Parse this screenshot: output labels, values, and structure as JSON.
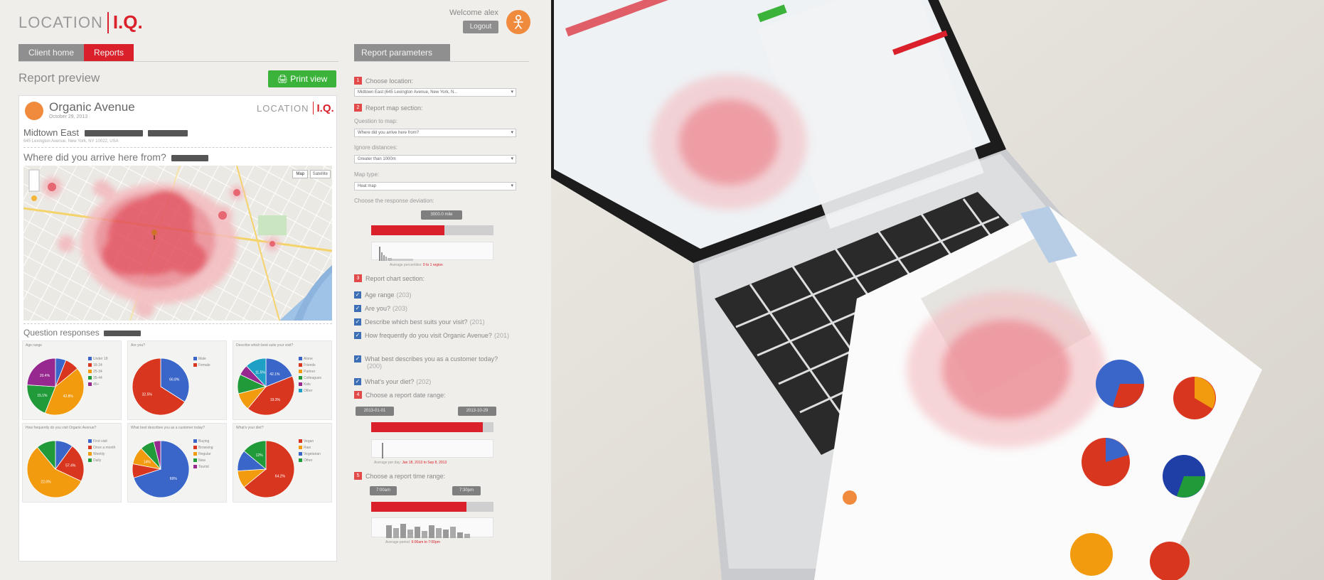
{
  "header": {
    "logo_left": "LOCATION",
    "logo_right": "I.Q.",
    "welcome": "Welcome alex",
    "logout_label": "Logout"
  },
  "breadcrumb": {
    "home": "Client home",
    "current": "Reports"
  },
  "preview": {
    "title": "Report preview",
    "print_label": "Print view"
  },
  "report": {
    "org": "Organic Avenue",
    "date": "October 29, 2013",
    "logo_left": "LOCATION",
    "logo_right": "I.Q.",
    "location": "Midtown East",
    "address": "645 Lexington Avenue, New York, NY 10022, USA",
    "question": "Where did you arrive here from?",
    "responses_title": "Question responses",
    "map_toggle": {
      "map": "Map",
      "satellite": "Satellite"
    }
  },
  "pies": [
    {
      "title": "Age range",
      "slices": [
        {
          "label": "Under 18",
          "value": 6,
          "color": "#3a66c9"
        },
        {
          "label": "18-24",
          "value": 8,
          "color": "#d9361f"
        },
        {
          "label": "25-34",
          "value": 42,
          "color": "#f39b0f"
        },
        {
          "label": "35-44",
          "value": 20,
          "color": "#219a3a"
        },
        {
          "label": "45+",
          "value": 24,
          "color": "#96288f"
        }
      ],
      "pct": [
        "42.8%",
        "20.4%",
        "15.1%"
      ]
    },
    {
      "title": "Are you?",
      "slices": [
        {
          "label": "Male",
          "value": 34,
          "color": "#3a66c9"
        },
        {
          "label": "Female",
          "value": 66,
          "color": "#d9361f"
        }
      ],
      "pct": [
        "32.5%",
        "66.8%"
      ]
    },
    {
      "title": "Describe which best suits your visit?",
      "slices": [
        {
          "label": "Alone",
          "value": 19,
          "color": "#3a66c9"
        },
        {
          "label": "Friends",
          "value": 42,
          "color": "#d9361f"
        },
        {
          "label": "Partner",
          "value": 10,
          "color": "#f39b0f"
        },
        {
          "label": "Colleagues",
          "value": 11,
          "color": "#219a3a"
        },
        {
          "label": "Kids",
          "value": 6,
          "color": "#96288f"
        },
        {
          "label": "Other",
          "value": 12,
          "color": "#1e9fc4"
        }
      ],
      "pct": [
        "19.3%",
        "42.1%",
        "11.5%"
      ]
    },
    {
      "title": "How frequently do you visit Organic Avenue?",
      "slices": [
        {
          "label": "First visit",
          "value": 10,
          "color": "#3a66c9"
        },
        {
          "label": "Once a month",
          "value": 22,
          "color": "#d9361f"
        },
        {
          "label": "Weekly",
          "value": 57,
          "color": "#f39b0f"
        },
        {
          "label": "Daily",
          "value": 11,
          "color": "#219a3a"
        }
      ],
      "pct": [
        "22.0%",
        "57.4%"
      ]
    },
    {
      "title": "What best describes you as a customer today?",
      "slices": [
        {
          "label": "Buying",
          "value": 70,
          "color": "#3a66c9"
        },
        {
          "label": "Browsing",
          "value": 8,
          "color": "#d9361f"
        },
        {
          "label": "Regular",
          "value": 10,
          "color": "#f39b0f"
        },
        {
          "label": "New",
          "value": 8,
          "color": "#219a3a"
        },
        {
          "label": "Tourist",
          "value": 4,
          "color": "#96288f"
        }
      ],
      "pct": [
        "69%",
        "14%"
      ]
    },
    {
      "title": "What's your diet?",
      "slices": [
        {
          "label": "Vegan",
          "value": 64,
          "color": "#d9361f"
        },
        {
          "label": "Raw",
          "value": 10,
          "color": "#f39b0f"
        },
        {
          "label": "Vegetarian",
          "value": 12,
          "color": "#3a66c9"
        },
        {
          "label": "Other",
          "value": 14,
          "color": "#219a3a"
        }
      ],
      "pct": [
        "64.2%",
        "12%"
      ]
    }
  ],
  "params": {
    "tab": "Report parameters",
    "step1": {
      "num": "1",
      "label": "Choose location:",
      "value": "Midtown East (645 Lexington Avenue, New York, N..."
    },
    "step2": {
      "num": "2",
      "label": "Report map section:"
    },
    "question_label": "Question to map:",
    "question_value": "Where did you arrive here from?",
    "ignore_label": "Ignore distances:",
    "ignore_value": "Greater than 1000m",
    "maptype_label": "Map type:",
    "maptype_value": "Heat map",
    "deviation_label": "Choose the response deviation:",
    "deviation_tag": "3000.0 mile",
    "deviation_fill": 0.6,
    "deviation_caption": "Average percentiles:",
    "deviation_caption_red": "0 to 1 region",
    "step3": {
      "num": "3",
      "label": "Report chart section:"
    },
    "checks": [
      {
        "label": "Age range",
        "count": "(203)"
      },
      {
        "label": "Are you?",
        "count": "(203)"
      },
      {
        "label": "Describe which best suits your visit?",
        "count": "(201)"
      },
      {
        "label": "How frequently do you visit Organic Avenue?",
        "count": "(201)"
      },
      {
        "label": "What best describes you as a customer today?",
        "count": "(200)"
      },
      {
        "label": "What's your diet?",
        "count": "(202)"
      }
    ],
    "step4": {
      "num": "4",
      "label": "Choose a report date range:"
    },
    "date_from": "2013-01-01",
    "date_to": "2013-10-29",
    "date_fill": 0.91,
    "date_caption": "Average per day:",
    "date_caption_red": "Jan 18, 2013 to Sep 8, 2013",
    "step5": {
      "num": "5",
      "label": "Choose a report time range:"
    },
    "time_from": "7:00am",
    "time_to": "7:30pm",
    "time_fill": 0.78,
    "time_caption": "Average period:",
    "time_caption_red": "6:00am to 7:00pm"
  },
  "colors": {
    "brand_red": "#d9202b",
    "print_green": "#3bb33b",
    "avatar_orange": "#f08a3c"
  }
}
